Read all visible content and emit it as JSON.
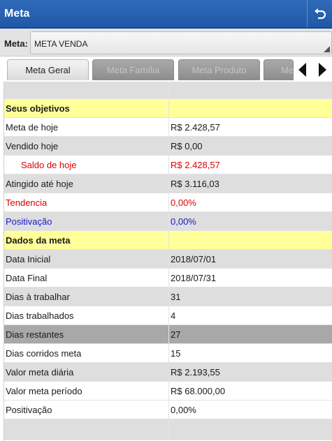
{
  "window": {
    "title": "Meta"
  },
  "meta_selector": {
    "label": "Meta:",
    "value": "META VENDA"
  },
  "tabs": [
    {
      "label": "Meta Geral",
      "active": true
    },
    {
      "label": "Meta Família",
      "active": false
    },
    {
      "label": "Meta Produto",
      "active": false
    },
    {
      "label": "Me",
      "active": false
    }
  ],
  "colors": {
    "title_bar": "#2463b0",
    "highlight_row": "#ffff99",
    "red_text": "#e00000",
    "blue_text": "#1a1ac8",
    "shaded_row": "#dedede",
    "dark_row": "#a8a8a8"
  },
  "rows": [
    {
      "label": "",
      "value": "",
      "style": "header-blank"
    },
    {
      "label": "Seus objetivos",
      "value": "",
      "style": "section"
    },
    {
      "label": "Meta de hoje",
      "value": "R$ 2.428,57",
      "style": "white"
    },
    {
      "label": "Vendido hoje",
      "value": "R$ 0,00",
      "style": "shaded"
    },
    {
      "label": "Saldo de hoje",
      "value": "R$ 2.428,57",
      "style": "white",
      "color": "red",
      "indent": true
    },
    {
      "label": "Atingido até hoje",
      "value": "R$ 3.116,03",
      "style": "shaded"
    },
    {
      "label": "Tendencia",
      "value": "0,00%",
      "style": "white",
      "color": "red"
    },
    {
      "label": "Positivação",
      "value": "0,00%",
      "style": "shaded",
      "color": "blue"
    },
    {
      "label": "Dados da meta",
      "value": "",
      "style": "section"
    },
    {
      "label": "Data Inicial",
      "value": "2018/07/01",
      "style": "shaded"
    },
    {
      "label": "Data Final",
      "value": "2018/07/31",
      "style": "white"
    },
    {
      "label": "Dias à trabalhar",
      "value": "31",
      "style": "shaded"
    },
    {
      "label": "Dias trabalhados",
      "value": "4",
      "style": "white"
    },
    {
      "label": "Dias restantes",
      "value": "27",
      "style": "dark"
    },
    {
      "label": "Dias corridos meta",
      "value": "15",
      "style": "white"
    },
    {
      "label": "Valor meta diária",
      "value": "R$ 2.193,55",
      "style": "shaded"
    },
    {
      "label": "Valor meta período",
      "value": "R$ 68.000,00",
      "style": "white"
    },
    {
      "label": "Positivação",
      "value": "0,00%",
      "style": "white"
    },
    {
      "label": "",
      "value": "",
      "style": "footer-blank"
    }
  ]
}
